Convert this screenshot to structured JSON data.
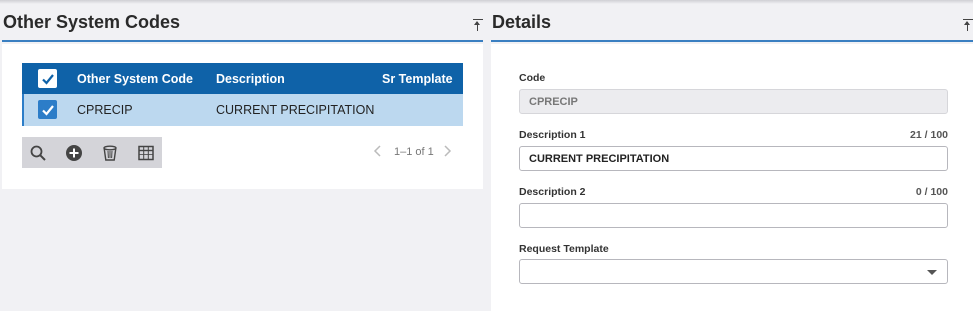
{
  "left_panel": {
    "title": "Other System Codes",
    "grid": {
      "columns": [
        "Other System Code",
        "Description",
        "Sr Template"
      ],
      "rows": [
        {
          "code": "CPRECIP",
          "description": "CURRENT PRECIPITATION",
          "sr_template": ""
        }
      ]
    },
    "toolbar": {
      "icons": [
        "search-icon",
        "add-icon",
        "delete-icon",
        "columns-icon"
      ]
    },
    "pager": {
      "text": "1–1 of 1"
    }
  },
  "details": {
    "title": "Details",
    "code": {
      "label": "Code",
      "value": "CPRECIP"
    },
    "description1": {
      "label": "Description 1",
      "value": "CURRENT PRECIPITATION",
      "count": "21 / 100"
    },
    "description2": {
      "label": "Description 2",
      "value": "",
      "count": "0 / 100"
    },
    "request_template": {
      "label": "Request Template",
      "value": ""
    }
  },
  "colors": {
    "grid_header": "#0f62a8",
    "selected_row": "#bcd8ef",
    "accent_line": "#3a7fc1",
    "toolbar_bg": "#d4d4d9"
  }
}
